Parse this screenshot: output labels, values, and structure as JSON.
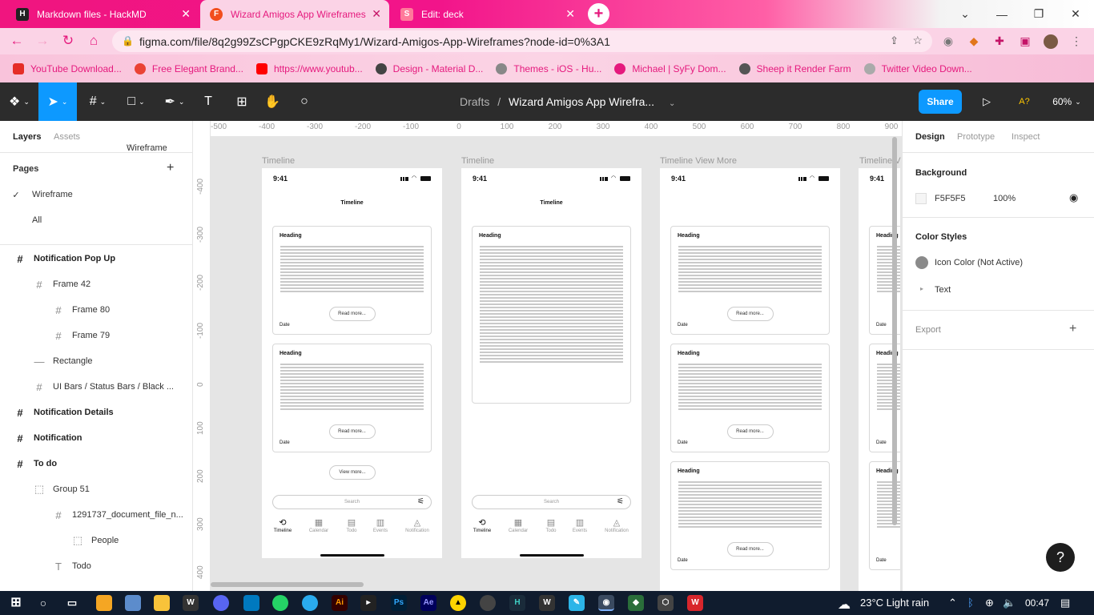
{
  "browser": {
    "tabs": [
      {
        "label": "Markdown files - HackMD",
        "fav": "H"
      },
      {
        "label": "Wizard Amigos App Wireframes",
        "fav": "F"
      },
      {
        "label": "Edit: deck",
        "fav": "S"
      }
    ],
    "url": "figma.com/file/8q2g99ZsCPgpCKE9zRqMy1/Wizard-Amigos-App-Wireframes?node-id=0%3A1",
    "bookmarks": [
      {
        "label": "YouTube Download...",
        "color": "#e52d27"
      },
      {
        "label": "Free Elegant Brand...",
        "color": "#ea4335"
      },
      {
        "label": "https://www.youtub...",
        "color": "#ff0000"
      },
      {
        "label": "Design - Material D...",
        "color": "#444444"
      },
      {
        "label": "Themes - iOS - Hu...",
        "color": "#888888"
      },
      {
        "label": "Michael | SyFy Dom...",
        "color": "#e5197d"
      },
      {
        "label": "Sheep it Render Farm",
        "color": "#555555"
      },
      {
        "label": "Twitter Video Down...",
        "color": "#aaaaaa"
      }
    ]
  },
  "figma": {
    "crumb_parent": "Drafts",
    "crumb_file": "Wizard Amigos App Wirefra...",
    "share_label": "Share",
    "a11y_label": "A?",
    "zoom": "60%"
  },
  "left_panel": {
    "tab_layers": "Layers",
    "tab_assets": "Assets",
    "page_selector": "Wireframe",
    "pages_title": "Pages",
    "pages": [
      "Wireframe",
      "All"
    ],
    "layers": [
      {
        "label": "Notification Pop Up",
        "glyph": "#",
        "indent": 0,
        "top": true
      },
      {
        "label": "Frame 42",
        "glyph": "#",
        "indent": 1,
        "top": false
      },
      {
        "label": "Frame 80",
        "glyph": "#",
        "indent": 2,
        "top": false
      },
      {
        "label": "Frame 79",
        "glyph": "#",
        "indent": 2,
        "top": false
      },
      {
        "label": "Rectangle",
        "glyph": "—",
        "indent": 1,
        "top": false
      },
      {
        "label": "UI Bars / Status Bars / Black ...",
        "glyph": "#",
        "indent": 1,
        "top": false
      },
      {
        "label": "Notification Details",
        "glyph": "#",
        "indent": 0,
        "top": true
      },
      {
        "label": "Notification",
        "glyph": "#",
        "indent": 0,
        "top": true
      },
      {
        "label": "To do",
        "glyph": "#",
        "indent": 0,
        "top": true
      },
      {
        "label": "Group 51",
        "glyph": "⬚",
        "indent": 1,
        "top": false
      },
      {
        "label": "1291737_document_file_n...",
        "glyph": "#",
        "indent": 2,
        "top": false
      },
      {
        "label": "People",
        "glyph": "⬚",
        "indent": 3,
        "top": false
      },
      {
        "label": "Todo",
        "glyph": "T",
        "indent": 2,
        "top": false
      }
    ]
  },
  "canvas": {
    "ruler_top": [
      "-500",
      "-400",
      "-300",
      "-200",
      "-100",
      "0",
      "100",
      "200",
      "300",
      "400",
      "500",
      "600",
      "700",
      "800",
      "900"
    ],
    "ruler_left": [
      "-400",
      "-300",
      "-200",
      "-100",
      "0",
      "100",
      "200",
      "300",
      "400"
    ],
    "frames": [
      {
        "label": "Timeline",
        "time": "9:41",
        "title": "Timeline",
        "type": "list"
      },
      {
        "label": "Timeline",
        "time": "9:41",
        "title": "Timeline",
        "type": "detail"
      },
      {
        "label": "Timeline View More",
        "time": "9:41",
        "title": "",
        "type": "more"
      },
      {
        "label": "Timeline V",
        "time": "9:41",
        "title": "",
        "type": "clip"
      }
    ],
    "card_heading": "Heading",
    "read_more": "Read more...",
    "date": "Date",
    "view_more": "View more...",
    "search": "Search",
    "nav": [
      "Timeline",
      "Calendar",
      "Todo",
      "Events",
      "Notification"
    ]
  },
  "right_panel": {
    "tab_design": "Design",
    "tab_prototype": "Prototype",
    "tab_inspect": "Inspect",
    "background_title": "Background",
    "bg_hex": "F5F5F5",
    "bg_opacity": "100%",
    "color_styles_title": "Color Styles",
    "style_icon": "Icon Color (Not Active)",
    "style_text": "Text",
    "export_title": "Export"
  },
  "taskbar": {
    "weather": "23°C  Light rain",
    "time": "00:47"
  },
  "colors": {
    "accent": "#0d99ff",
    "chrome_pink": "#f0157f",
    "toolbar": "#2c2c2c"
  }
}
